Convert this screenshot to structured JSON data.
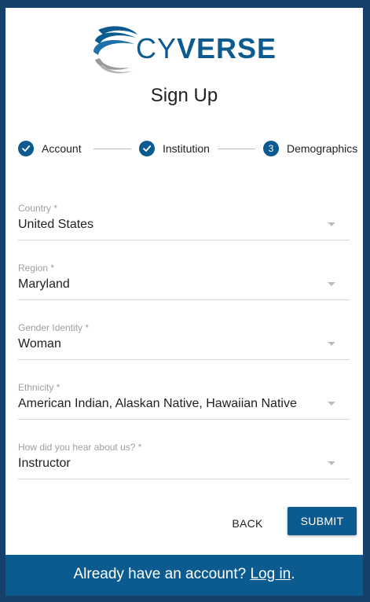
{
  "brand": {
    "logo_text_light": "CY",
    "logo_text_bold": "VERSE",
    "logo_icon": "cyverse-swoosh-icon",
    "color": "#0b5b91"
  },
  "title": "Sign Up",
  "stepper": {
    "steps": [
      {
        "label": "Account",
        "state": "completed",
        "icon": "check-icon"
      },
      {
        "label": "Institution",
        "state": "completed",
        "icon": "check-icon"
      },
      {
        "label": "Demographics",
        "state": "active",
        "number": "3"
      }
    ]
  },
  "fields": [
    {
      "label": "Country *",
      "value": "United States"
    },
    {
      "label": "Region *",
      "value": "Maryland"
    },
    {
      "label": "Gender Identity *",
      "value": "Woman"
    },
    {
      "label": "Ethnicity *",
      "value": "American Indian, Alaskan Native, Hawaiian Native"
    },
    {
      "label": "How did you hear about us? *",
      "value": "Instructor"
    }
  ],
  "actions": {
    "back_label": "BACK",
    "submit_label": "SUBMIT"
  },
  "footer": {
    "prompt": "Already have an account?",
    "link": "Log in",
    "suffix": "."
  },
  "colors": {
    "background": "#16416b",
    "accent": "#0b5b91"
  }
}
